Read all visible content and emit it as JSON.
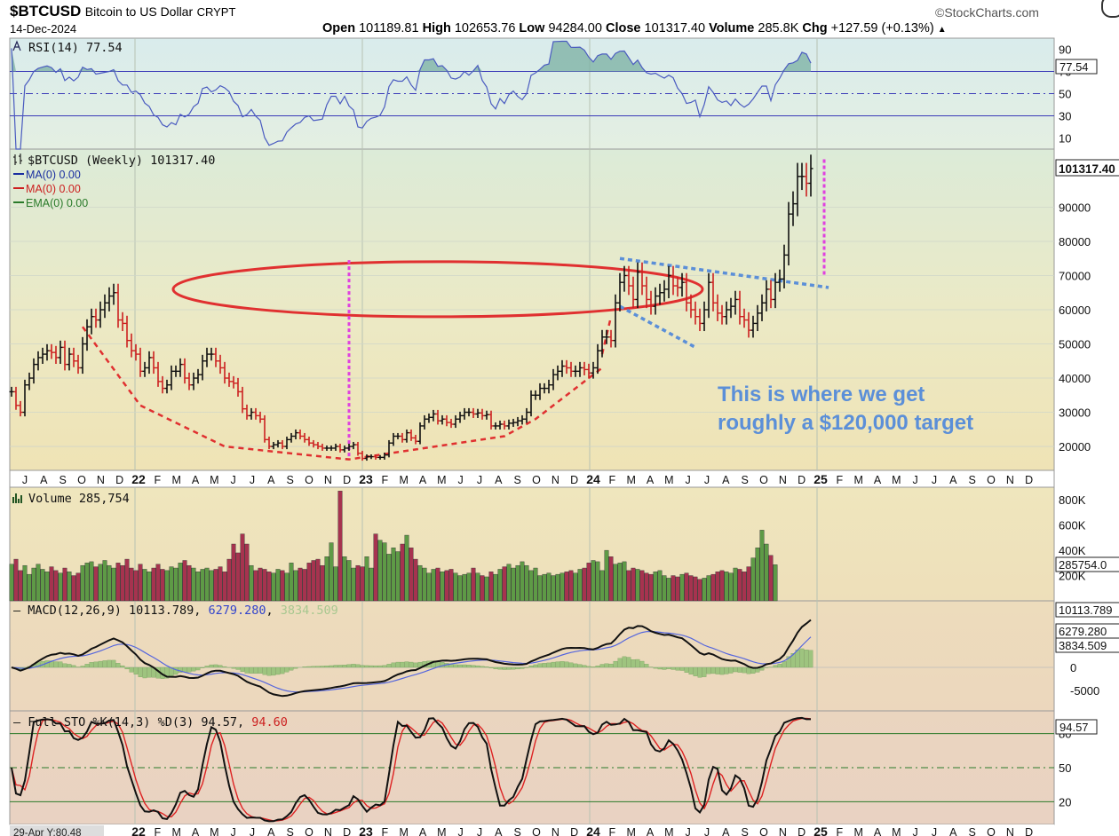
{
  "header": {
    "symbol": "$BTCUSD",
    "name": "Bitcoin to US Dollar",
    "exchange": "CRYPT",
    "date": "14-Dec-2024",
    "watermark": "StockCharts.com",
    "ohlc": {
      "open_label": "Open",
      "open": "101189.81",
      "high_label": "High",
      "high": "102653.76",
      "low_label": "Low",
      "low": "94284.00",
      "close_label": "Close",
      "close": "101317.40",
      "volume_label": "Volume",
      "volume": "285.8K",
      "chg_label": "Chg",
      "chg": "+127.59 (+0.13%)"
    }
  },
  "panels": {
    "rsi": {
      "label": "RSI(14) 77.54",
      "current": "77.54",
      "ticks": [
        "90",
        "70",
        "50",
        "30",
        "10"
      ]
    },
    "price": {
      "label": "$BTCUSD (Weekly) 101317.40",
      "current": "101317.40",
      "legend": [
        {
          "text": "MA(0) 0.00",
          "color": "#1a2fa0"
        },
        {
          "text": "MA(0) 0.00",
          "color": "#cc2020"
        },
        {
          "text": "EMA(0) 0.00",
          "color": "#2a7a2a"
        }
      ],
      "ticks": [
        "90000",
        "80000",
        "70000",
        "60000",
        "50000",
        "40000",
        "30000",
        "20000"
      ],
      "annotation_line1": "This is where we get",
      "annotation_line2": "roughly a $120,000 target"
    },
    "volume": {
      "label": "Volume 285,754",
      "current": "285754.0",
      "ticks": [
        "800K",
        "600K",
        "400K",
        "200K"
      ]
    },
    "macd": {
      "label_prefix": "MACD(12,26,9) 10113.789, ",
      "label_signal": "6279.280",
      "label_sep": ", ",
      "label_hist": "3834.509",
      "current_macd": "10113.789",
      "current_signal": "6279.280",
      "current_hist": "3834.509",
      "ticks": [
        "0",
        "-5000"
      ]
    },
    "sto": {
      "label_prefix": "Full STO %K(14,3) %D(3) 94.57, ",
      "label_d": "94.60",
      "current": "94.57",
      "ticks": [
        "80",
        "50",
        "20"
      ]
    }
  },
  "x_axis": {
    "labels": [
      "J",
      "A",
      "S",
      "O",
      "N",
      "D",
      "22",
      "F",
      "M",
      "A",
      "M",
      "J",
      "J",
      "A",
      "S",
      "O",
      "N",
      "D",
      "23",
      "F",
      "M",
      "A",
      "M",
      "J",
      "J",
      "A",
      "S",
      "O",
      "N",
      "D",
      "24",
      "F",
      "M",
      "A",
      "M",
      "J",
      "J",
      "A",
      "S",
      "O",
      "N",
      "D",
      "25",
      "F",
      "M",
      "A",
      "M",
      "J",
      "J",
      "A",
      "S",
      "O",
      "N",
      "D"
    ],
    "bottom_note": "29-Apr Y:80.48"
  },
  "chart_data": {
    "type": "candlestick",
    "title": "$BTCUSD Bitcoin to US Dollar (Weekly)",
    "date": "14-Dec-2024",
    "ohlc_last": {
      "open": 101189.81,
      "high": 102653.76,
      "low": 94284.0,
      "close": 101317.4,
      "volume": 285754,
      "change": 127.59,
      "change_pct": 0.13
    },
    "price_axis": {
      "ylim": [
        13000,
        107000
      ],
      "ticks": [
        20000,
        30000,
        40000,
        50000,
        60000,
        70000,
        80000,
        90000
      ]
    },
    "x_range": [
      "2021-07",
      "2025-12"
    ],
    "weekly_close": [
      36000,
      32000,
      30000,
      38000,
      40000,
      44000,
      46000,
      47000,
      48000,
      47500,
      46000,
      49000,
      44000,
      47000,
      45000,
      43000,
      50000,
      55000,
      58000,
      57000,
      60000,
      62000,
      64000,
      65000,
      57000,
      56000,
      51000,
      48000,
      47000,
      42000,
      43000,
      46000,
      43000,
      39000,
      37000,
      38000,
      42000,
      42000,
      44000,
      40000,
      38000,
      40000,
      41000,
      45000,
      47000,
      47000,
      45000,
      43000,
      40000,
      39000,
      38500,
      36000,
      31000,
      29000,
      30000,
      29000,
      28000,
      22000,
      20000,
      20500,
      21000,
      20000,
      22000,
      23000,
      24000,
      23000,
      22000,
      21000,
      20500,
      20000,
      19500,
      19500,
      19500,
      20000,
      19000,
      19500,
      20000,
      20500,
      18000,
      16500,
      17000,
      17000,
      16800,
      16800,
      17500,
      21000,
      23000,
      23000,
      22000,
      24000,
      22500,
      21500,
      26000,
      28000,
      28500,
      29500,
      27500,
      28000,
      27000,
      26500,
      28000,
      29000,
      30000,
      30000,
      29500,
      29800,
      29000,
      29300,
      26000,
      26000,
      26500,
      26000,
      26800,
      27000,
      27500,
      28000,
      30000,
      35000,
      35000,
      37000,
      37000,
      38000,
      41000,
      42000,
      43500,
      43000,
      42000,
      42000,
      43000,
      42500,
      41500,
      43000,
      48000,
      52000,
      52000,
      51000,
      62000,
      68000,
      70000,
      67000,
      63000,
      71000,
      67000,
      63000,
      61000,
      64000,
      65000,
      66000,
      70000,
      67000,
      66500,
      68000,
      62000,
      60000,
      58000,
      56000,
      60000,
      68000,
      62000,
      59000,
      58000,
      60000,
      61000,
      63000,
      58000,
      57000,
      54000,
      56000,
      59000,
      62000,
      66000,
      63000,
      68000,
      69000,
      76000,
      88000,
      91000,
      99000,
      99000,
      97000,
      101317
    ],
    "volume_k": [
      290,
      330,
      240,
      280,
      210,
      260,
      290,
      250,
      230,
      270,
      240,
      220,
      260,
      230,
      200,
      220,
      280,
      300,
      310,
      270,
      290,
      320,
      280,
      260,
      300,
      280,
      330,
      260,
      240,
      290,
      250,
      230,
      260,
      290,
      250,
      240,
      270,
      260,
      300,
      320,
      280,
      260,
      230,
      250,
      260,
      240,
      250,
      270,
      230,
      330,
      450,
      380,
      530,
      450,
      280,
      240,
      260,
      250,
      230,
      220,
      250,
      240,
      220,
      300,
      240,
      260,
      250,
      300,
      320,
      330,
      280,
      350,
      460,
      270,
      870,
      350,
      320,
      260,
      280,
      270,
      350,
      260,
      530,
      480,
      460,
      370,
      420,
      390,
      450,
      520,
      420,
      330,
      280,
      260,
      220,
      250,
      260,
      230,
      240,
      250,
      220,
      200,
      210,
      220,
      260,
      220,
      200,
      190,
      230,
      210,
      250,
      270,
      290,
      260,
      280,
      310,
      280,
      240,
      260,
      200,
      210,
      220,
      200,
      210,
      220,
      230,
      240,
      220,
      250,
      260,
      300,
      320,
      310,
      240,
      400,
      350,
      290,
      300,
      310,
      240,
      260,
      250,
      240,
      220,
      210,
      230,
      240,
      200,
      180,
      200,
      190,
      210,
      220,
      200,
      190,
      170,
      180,
      200,
      210,
      230,
      240,
      230,
      220,
      260,
      250,
      230,
      270,
      340,
      420,
      560,
      450,
      360,
      286
    ],
    "rsi": {
      "current": 77.54,
      "levels": [
        70,
        50,
        30
      ],
      "ylim": [
        0,
        100
      ]
    },
    "macd": {
      "macd": 10113.789,
      "signal": 6279.28,
      "histogram": 3834.509,
      "ticks": [
        0,
        -5000
      ]
    },
    "full_sto": {
      "k": 94.57,
      "d": 94.6,
      "levels": [
        80,
        50,
        20
      ]
    },
    "annotations": [
      "This is where we get roughly a $120,000 target"
    ]
  }
}
